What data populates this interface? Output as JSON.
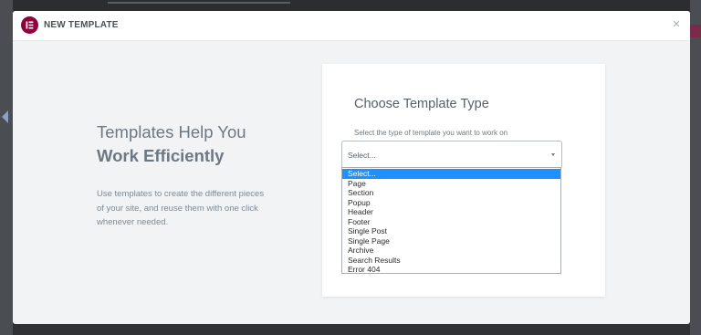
{
  "modal": {
    "title": "NEW TEMPLATE",
    "close_symbol": "×"
  },
  "intro": {
    "title": "Templates Help You",
    "title_bold": "Work Efficiently",
    "description": "Use templates to create the different pieces of your site, and reuse them with one click whenever needed."
  },
  "form": {
    "title": "Choose Template Type",
    "label": "Select the type of template you want to work on",
    "select_value": "Select...",
    "options": [
      "Select...",
      "Page",
      "Section",
      "Popup",
      "Header",
      "Footer",
      "Single Post",
      "Single Page",
      "Archive",
      "Search Results",
      "Error 404"
    ],
    "selected_option": "Select..."
  },
  "icons": {
    "logo": "elementor-logo-icon",
    "close": "close-icon",
    "dropdown": "chevron-down-icon"
  },
  "colors": {
    "brand": "#92003b",
    "highlight": "#1e90ff",
    "accent_green": "#39b54a",
    "modal_bg": "#f1f3f5"
  }
}
